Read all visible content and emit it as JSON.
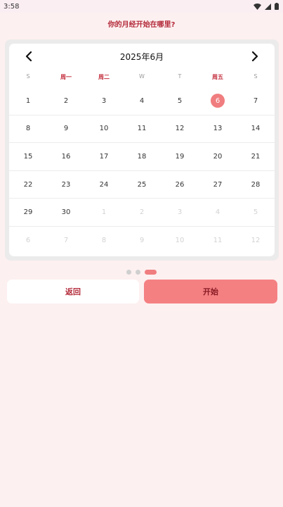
{
  "status": {
    "time": "3:58"
  },
  "prompt": "你的月经开始在哪里?",
  "calendar": {
    "title": "2025年6月",
    "weekdays": [
      "S",
      "周一",
      "周二",
      "W",
      "T",
      "周五",
      "S"
    ],
    "rows": [
      [
        {
          "d": "1"
        },
        {
          "d": "2"
        },
        {
          "d": "3"
        },
        {
          "d": "4"
        },
        {
          "d": "5"
        },
        {
          "d": "6",
          "sel": true
        },
        {
          "d": "7"
        }
      ],
      [
        {
          "d": "8"
        },
        {
          "d": "9"
        },
        {
          "d": "10"
        },
        {
          "d": "11"
        },
        {
          "d": "12"
        },
        {
          "d": "13"
        },
        {
          "d": "14"
        }
      ],
      [
        {
          "d": "15"
        },
        {
          "d": "16"
        },
        {
          "d": "17"
        },
        {
          "d": "18"
        },
        {
          "d": "19"
        },
        {
          "d": "20"
        },
        {
          "d": "21"
        }
      ],
      [
        {
          "d": "22"
        },
        {
          "d": "23"
        },
        {
          "d": "24"
        },
        {
          "d": "25"
        },
        {
          "d": "26"
        },
        {
          "d": "27"
        },
        {
          "d": "28"
        }
      ],
      [
        {
          "d": "29"
        },
        {
          "d": "30"
        },
        {
          "d": "1",
          "muted": true
        },
        {
          "d": "2",
          "muted": true
        },
        {
          "d": "3",
          "muted": true
        },
        {
          "d": "4",
          "muted": true
        },
        {
          "d": "5",
          "muted": true
        }
      ],
      [
        {
          "d": "6",
          "muted": true
        },
        {
          "d": "7",
          "muted": true
        },
        {
          "d": "8",
          "muted": true
        },
        {
          "d": "9",
          "muted": true
        },
        {
          "d": "10",
          "muted": true
        },
        {
          "d": "11",
          "muted": true
        },
        {
          "d": "12",
          "muted": true
        }
      ]
    ]
  },
  "pager": {
    "current": 3,
    "total": 3
  },
  "buttons": {
    "back": "返回",
    "start": "开始"
  },
  "colors": {
    "accent": "#f07d7f",
    "title_red": "#b32a3a",
    "background": "#fdf0f0"
  }
}
